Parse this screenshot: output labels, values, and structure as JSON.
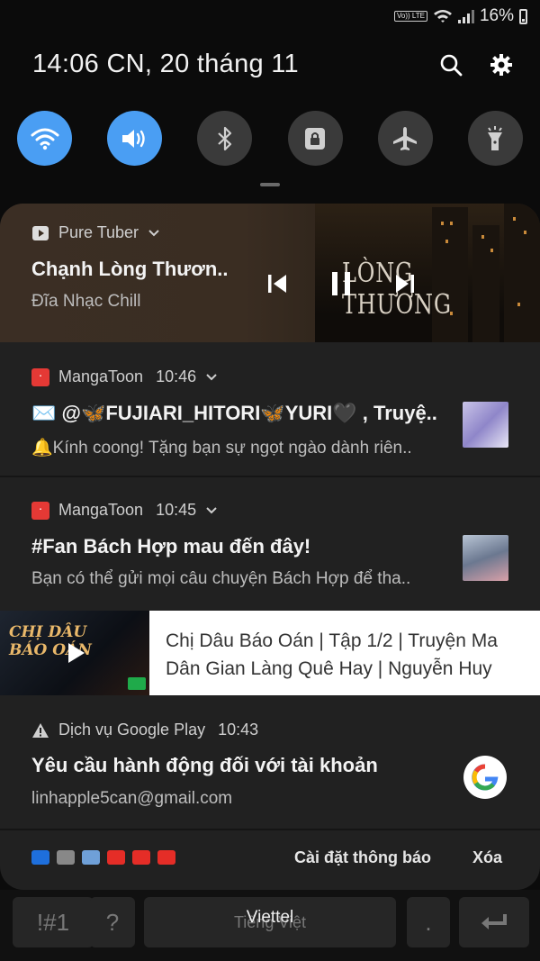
{
  "status_bar": {
    "battery": "16%",
    "volte": "Vo)) LTE"
  },
  "header": {
    "time": "14:06",
    "date": "CN, 20 tháng 11"
  },
  "quick_settings": [
    {
      "icon": "wifi-icon",
      "active": true
    },
    {
      "icon": "sound-icon",
      "active": true
    },
    {
      "icon": "bluetooth-icon",
      "active": false
    },
    {
      "icon": "rotation-lock-icon",
      "active": false
    },
    {
      "icon": "airplane-icon",
      "active": false
    },
    {
      "icon": "flashlight-icon",
      "active": false
    }
  ],
  "media": {
    "app": "Pure Tuber",
    "title": "Chạnh Lòng Thươn..",
    "subtitle": "Đĩa Nhạc Chill",
    "art_text": "LÒNG THƯƠNG"
  },
  "notifications": [
    {
      "app": "MangaToon",
      "time": "10:46",
      "title": "✉️ @🦋FUJIARI_HITORI🦋YURI🖤 , Truyệ..",
      "body": "🔔Kính coong! Tặng bạn sự ngọt ngào dành riên.."
    },
    {
      "app": "MangaToon",
      "time": "10:45",
      "title": "#Fan Bách Hợp mau đến đây!",
      "body": "Bạn có thể gửi mọi câu chuyện Bách Hợp để tha.."
    }
  ],
  "youtube": {
    "text": "Chị Dâu Báo Oán | Tập 1/2 | Truyện Ma Dân Gian Làng Quê Hay | Nguyễn Huy",
    "thumb_title": "CHỊ DÂU BÁO OÁN"
  },
  "google_play": {
    "app": "Dịch vụ Google Play",
    "time": "10:43",
    "title": "Yêu cầu hành động đối với tài khoản",
    "body": "linhapple5can@gmail.com"
  },
  "footer": {
    "settings_label": "Cài đặt thông báo",
    "clear_label": "Xóa"
  },
  "keyboard": {
    "symbols": "!#1",
    "question": "?",
    "language": "Tiếng Việt",
    "dot": "."
  },
  "carrier": "Viettel",
  "colors": {
    "accent": "#4a9ef3",
    "panel": "#212121",
    "mangatoon": "#e53935"
  }
}
